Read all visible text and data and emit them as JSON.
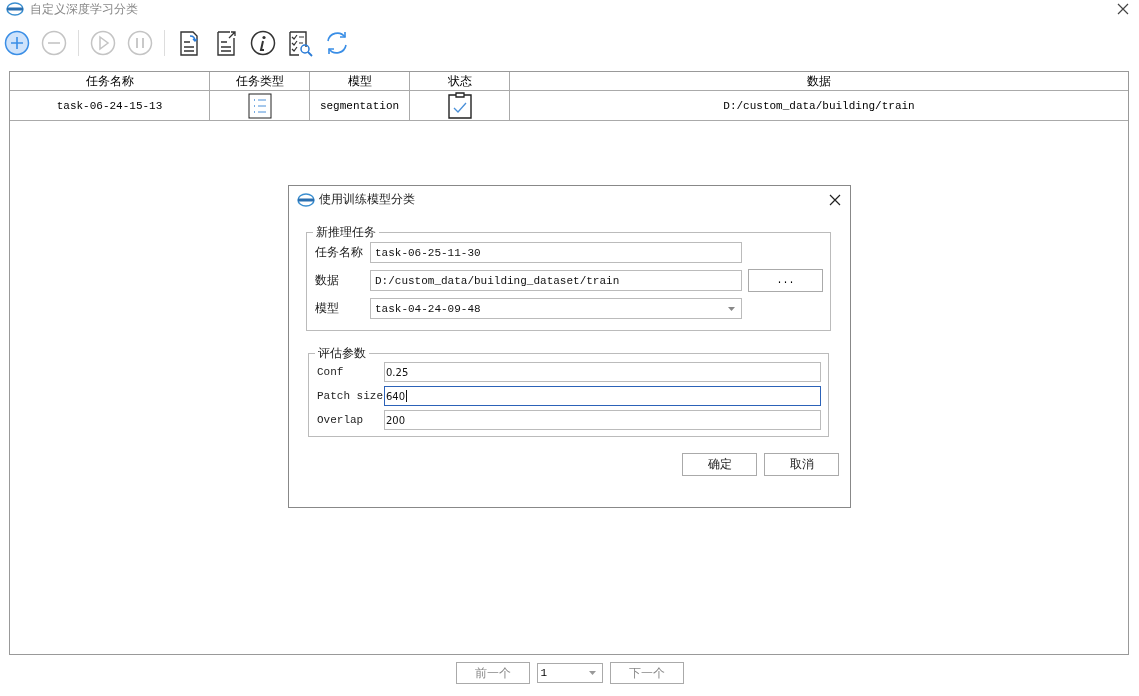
{
  "window": {
    "title": "自定义深度学习分类"
  },
  "toolbar": [
    {
      "kind": "add",
      "disabled": false,
      "selected": true
    },
    {
      "kind": "remove",
      "disabled": true,
      "selected": false
    },
    {
      "kind": "play",
      "disabled": true,
      "selected": false
    },
    {
      "kind": "pause",
      "disabled": true,
      "selected": false
    },
    {
      "kind": "import",
      "disabled": false,
      "selected": false
    },
    {
      "kind": "export",
      "disabled": false,
      "selected": false
    },
    {
      "kind": "info",
      "disabled": false,
      "selected": false
    },
    {
      "kind": "inspect",
      "disabled": false,
      "selected": false
    },
    {
      "kind": "refresh",
      "disabled": false,
      "selected": false
    }
  ],
  "table": {
    "columns": [
      "任务名称",
      "任务类型",
      "模型",
      "状态",
      "数据"
    ],
    "rows": [
      {
        "name": "task-06-24-15-13",
        "model": "segmentation",
        "data": "D:/custom_data/building/train",
        "selected": false
      }
    ]
  },
  "dialog": {
    "title": "使用训练模型分类",
    "group_1": {
      "title": "新推理任务",
      "fields": [
        {
          "kind": "text",
          "label": "任务名称",
          "value": "task-06-25-11-30"
        },
        {
          "kind": "browse",
          "label": "数据",
          "value": "D:/custom_data/building_dataset/train",
          "button": "..."
        },
        {
          "kind": "select",
          "label": "模型",
          "value": "task-04-24-09-48"
        }
      ]
    },
    "group_2": {
      "title": "评估参数",
      "fields": [
        {
          "label": "Conf",
          "value": "0.25",
          "focused": false
        },
        {
          "label": "Patch size",
          "value": "640",
          "focused": true
        },
        {
          "label": "Overlap",
          "value": "200",
          "focused": false
        }
      ]
    },
    "buttons": [
      "确定",
      "取消"
    ]
  },
  "pagination": {
    "previous": {
      "label": "前一个",
      "disabled": true
    },
    "page": "1",
    "next": {
      "label": "下一个",
      "disabled": true
    }
  }
}
